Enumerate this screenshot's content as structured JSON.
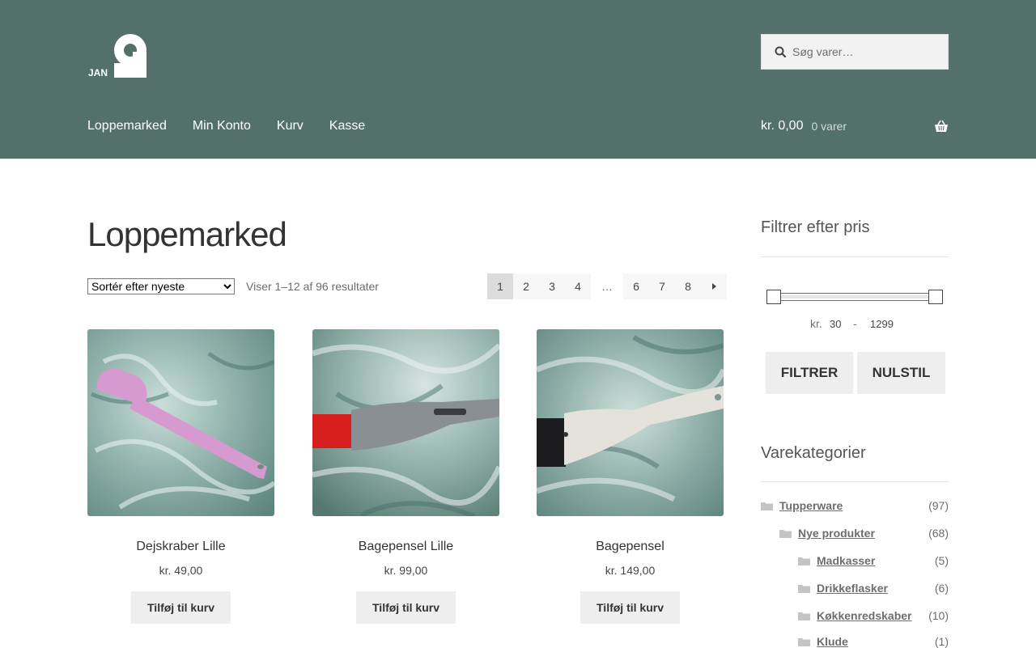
{
  "header": {
    "logo_text": "JAN",
    "search": {
      "placeholder": "Søg varer…"
    },
    "nav": [
      {
        "label": "Loppemarked"
      },
      {
        "label": "Min Konto"
      },
      {
        "label": "Kurv"
      },
      {
        "label": "Kasse"
      }
    ],
    "cart": {
      "amount": "kr. 0,00",
      "count": "0 varer"
    }
  },
  "main": {
    "title": "Loppemarked",
    "sort_selected": "Sortér efter nyeste",
    "result_count": "Viser 1–12 af 96 resultater",
    "pagination": [
      "1",
      "2",
      "3",
      "4",
      "…",
      "6",
      "7",
      "8"
    ],
    "current_page": "1",
    "products": [
      {
        "name": "Dejskraber Lille",
        "price": "kr. 49,00",
        "button": "Tilføj til kurv",
        "color": "#d69ad0"
      },
      {
        "name": "Bagepensel Lille",
        "price": "kr. 99,00",
        "button": "Tilføj til kurv",
        "color": "#8a8f94"
      },
      {
        "name": "Bagepensel",
        "price": "kr. 149,00",
        "button": "Tilføj til kurv",
        "color": "#e4e2da"
      }
    ]
  },
  "sidebar": {
    "price_filter": {
      "title": "Filtrer efter pris",
      "currency": "kr.",
      "min": "30",
      "separator": "-",
      "max": "1299",
      "filter_button": "FILTRER",
      "reset_button": "NULSTIL"
    },
    "categories": {
      "title": "Varekategorier",
      "items": [
        {
          "label": "Tupperware",
          "count": "(97)"
        },
        {
          "label": "Nye produkter",
          "count": "(68)"
        },
        {
          "label": "Madkasser",
          "count": "(5)"
        },
        {
          "label": "Drikkeflasker",
          "count": "(6)"
        },
        {
          "label": "Køkkenredskaber",
          "count": "(10)"
        },
        {
          "label": "Klude",
          "count": "(1)"
        }
      ]
    }
  },
  "colors": {
    "header_bg": "#53706b",
    "button_bg": "#eeeeee",
    "text": "#43454b"
  }
}
